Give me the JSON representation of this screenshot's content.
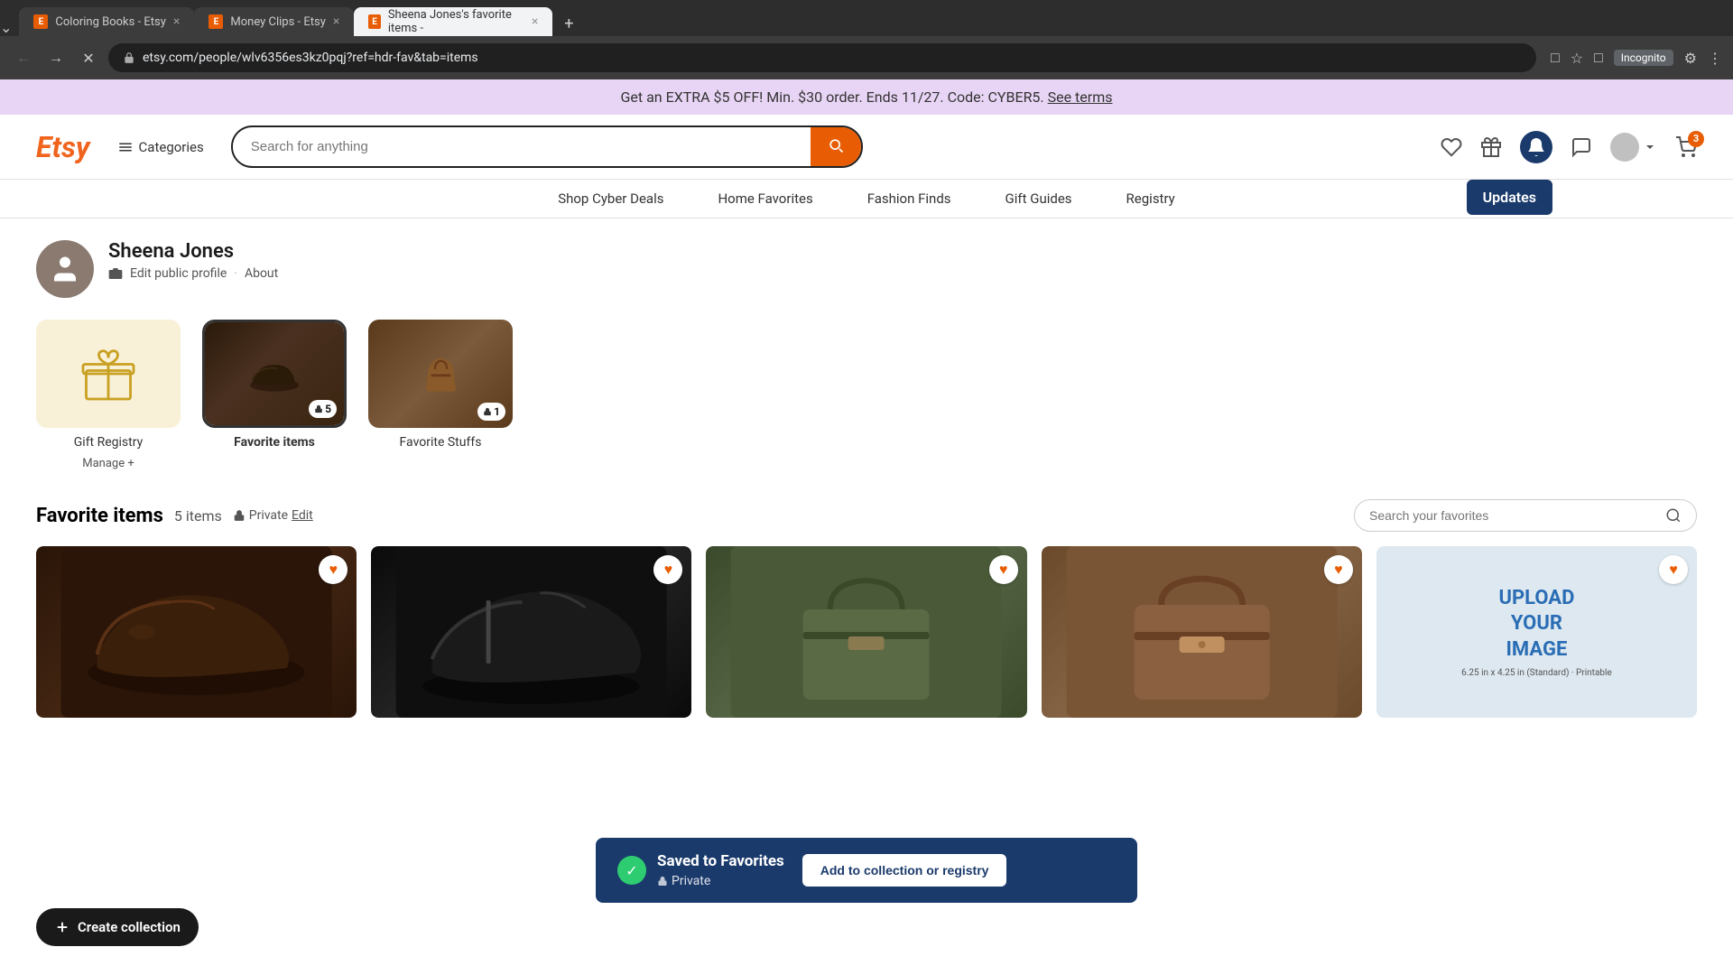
{
  "browser": {
    "tabs": [
      {
        "id": "tab1",
        "label": "Coloring Books - Etsy",
        "active": false,
        "icon": "E"
      },
      {
        "id": "tab2",
        "label": "Money Clips - Etsy",
        "active": false,
        "icon": "E"
      },
      {
        "id": "tab3",
        "label": "Sheena Jones's favorite items -",
        "active": true,
        "icon": "E"
      }
    ],
    "address": "etsy.com/people/wlv6356es3kz0pqj?ref=hdr-fav&tab=items",
    "incognito_label": "Incognito"
  },
  "promo": {
    "text": "Get an EXTRA $5 OFF! Min. $30 order. Ends 11/27. Code: CYBER5.",
    "link_text": "See terms",
    "link": "#"
  },
  "header": {
    "logo": "Etsy",
    "categories_label": "Categories",
    "search_placeholder": "Search for anything",
    "updates_tooltip": "Updates"
  },
  "nav": {
    "items": [
      {
        "id": "shop-cyber-deals",
        "label": "Shop Cyber Deals"
      },
      {
        "id": "home-favorites",
        "label": "Home Favorites"
      },
      {
        "id": "fashion-finds",
        "label": "Fashion Finds"
      },
      {
        "id": "gift-guides",
        "label": "Gift Guides"
      },
      {
        "id": "registry",
        "label": "Registry"
      }
    ]
  },
  "user": {
    "name": "Sheena Jones",
    "edit_profile_label": "Edit public profile",
    "about_label": "About"
  },
  "collections": [
    {
      "id": "gift-registry",
      "name": "Gift Registry",
      "type": "gift",
      "manage_label": "Manage +"
    },
    {
      "id": "favorite-items",
      "name": "Favorite items",
      "type": "shoes",
      "count": 5,
      "locked": true,
      "active": true
    },
    {
      "id": "favorite-stuffs",
      "name": "Favorite Stuffs",
      "type": "bag",
      "count": 1,
      "locked": true
    }
  ],
  "favorites_section": {
    "title": "Favorite items",
    "count": "5 items",
    "private_label": "Private",
    "edit_label": "Edit",
    "search_placeholder": "Search your favorites"
  },
  "items": [
    {
      "id": "item1",
      "type": "shoes-dark",
      "alt": "Dark loafers"
    },
    {
      "id": "item2",
      "type": "shoes-black",
      "alt": "Black dress shoes"
    },
    {
      "id": "item3",
      "type": "bag-green",
      "alt": "Green bag"
    },
    {
      "id": "item4",
      "type": "bag-brown",
      "alt": "Brown leather bag"
    },
    {
      "id": "item5",
      "type": "upload",
      "alt": "Upload your image"
    }
  ],
  "create_collection": {
    "label": "Create collection"
  },
  "toast": {
    "title": "Saved to Favorites",
    "subtitle": "Private",
    "action_label": "Add to collection or registry",
    "check_icon": "✓"
  }
}
